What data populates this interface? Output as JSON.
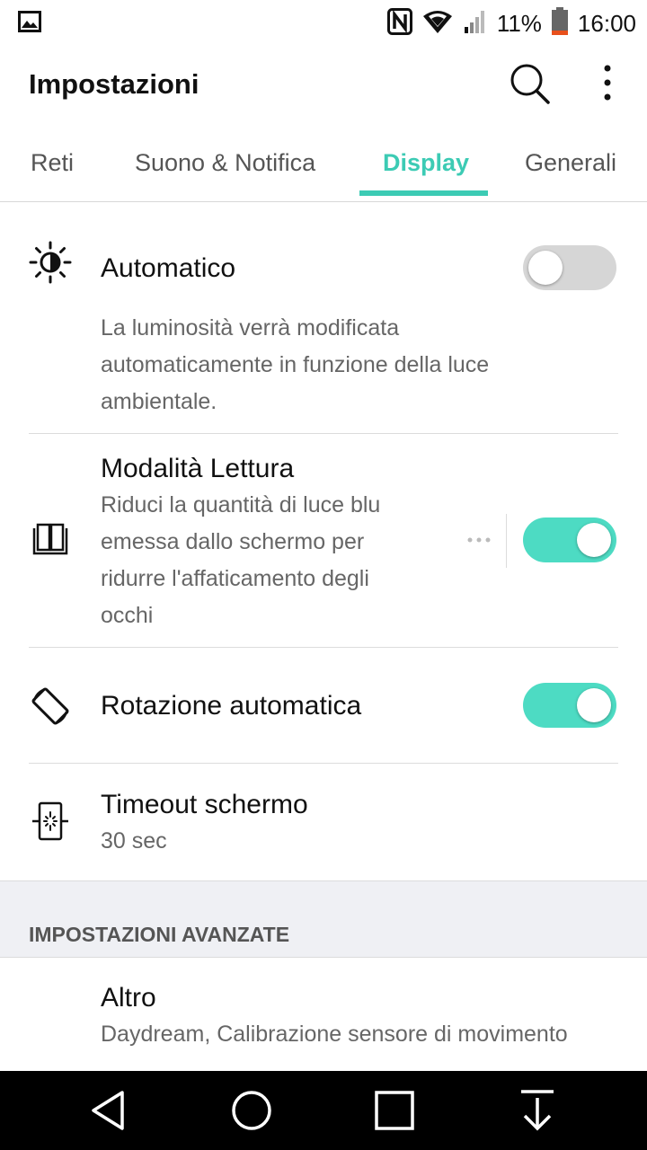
{
  "status_bar": {
    "battery_percent": "11%",
    "time": "16:00"
  },
  "app_bar": {
    "title": "Impostazioni"
  },
  "tabs": [
    {
      "label": "Reti"
    },
    {
      "label": "Suono & Notifica"
    },
    {
      "label": "Display",
      "active": true
    },
    {
      "label": "Generali"
    }
  ],
  "settings": {
    "auto_brightness": {
      "title": "Automatico",
      "description_lines": [
        "La luminosità verrà modificata",
        "automaticamente in funzione della luce",
        "ambientale."
      ],
      "enabled": false
    },
    "reading_mode": {
      "title": "Modalità Lettura",
      "description_lines": [
        "Riduci la quantità di luce blu",
        "emessa dallo schermo per",
        "ridurre l'affaticamento degli",
        "occhi"
      ],
      "enabled": true
    },
    "auto_rotate": {
      "title": "Rotazione automatica",
      "enabled": true
    },
    "screen_timeout": {
      "title": "Timeout schermo",
      "value": "30 sec"
    }
  },
  "advanced": {
    "section_title": "IMPOSTAZIONI AVANZATE",
    "other_title": "Altro",
    "other_subtitle": "Daydream, Calibrazione sensore di movimento"
  },
  "colors": {
    "accent": "#3ccbb4",
    "toggle_on": "#4ddbc3",
    "toggle_off": "#d6d6d6"
  },
  "icons": {
    "status": [
      "image-notification-icon",
      "nfc-icon",
      "wifi-icon",
      "signal-icon",
      "battery-icon"
    ],
    "toolbar": [
      "search-icon",
      "more-vert-icon"
    ],
    "rows": [
      "brightness-icon",
      "book-icon",
      "screen-rotation-icon",
      "screen-timeout-icon"
    ],
    "nav": [
      "back-icon",
      "home-icon",
      "recents-icon",
      "notification-pull-icon"
    ]
  }
}
